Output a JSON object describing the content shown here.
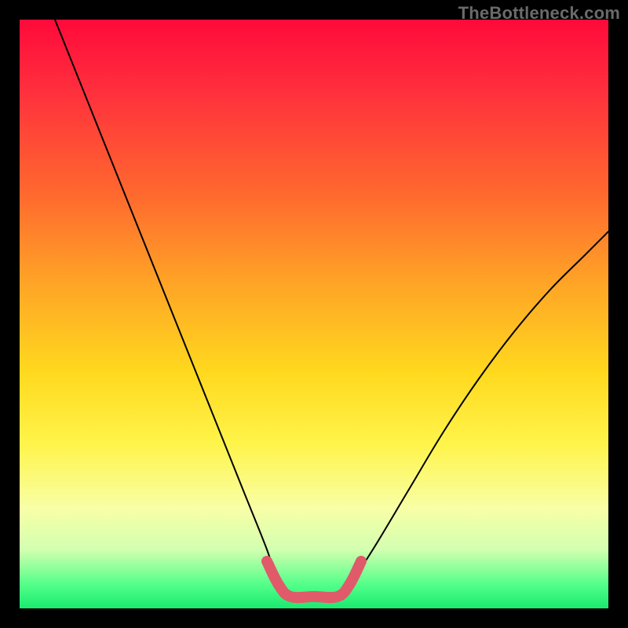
{
  "watermark": "TheBottleneck.com",
  "colors": {
    "frame": "#000000",
    "gradient_top": "#ff0a3a",
    "gradient_bottom": "#19e96f",
    "curve": "#000000",
    "highlight": "#e05a6a"
  },
  "chart_data": {
    "type": "line",
    "title": "",
    "xlabel": "",
    "ylabel": "",
    "xlim": [
      0,
      1
    ],
    "ylim": [
      0,
      1
    ],
    "grid": false,
    "legend": "none",
    "annotations": [
      "TheBottleneck.com"
    ],
    "series": [
      {
        "name": "curve",
        "x": [
          0.06,
          0.1,
          0.14,
          0.18,
          0.22,
          0.26,
          0.3,
          0.34,
          0.38,
          0.42,
          0.44,
          0.46,
          0.5,
          0.54,
          0.56,
          0.6,
          0.66,
          0.72,
          0.78,
          0.84,
          0.9,
          0.96,
          1.0
        ],
        "y": [
          1.0,
          0.9,
          0.8,
          0.7,
          0.6,
          0.5,
          0.4,
          0.3,
          0.2,
          0.1,
          0.04,
          0.02,
          0.02,
          0.02,
          0.04,
          0.1,
          0.2,
          0.3,
          0.39,
          0.47,
          0.54,
          0.6,
          0.64
        ]
      },
      {
        "name": "highlight",
        "x": [
          0.42,
          0.44,
          0.46,
          0.5,
          0.54,
          0.56,
          0.58
        ],
        "y": [
          0.08,
          0.04,
          0.02,
          0.02,
          0.02,
          0.04,
          0.08
        ]
      }
    ]
  }
}
